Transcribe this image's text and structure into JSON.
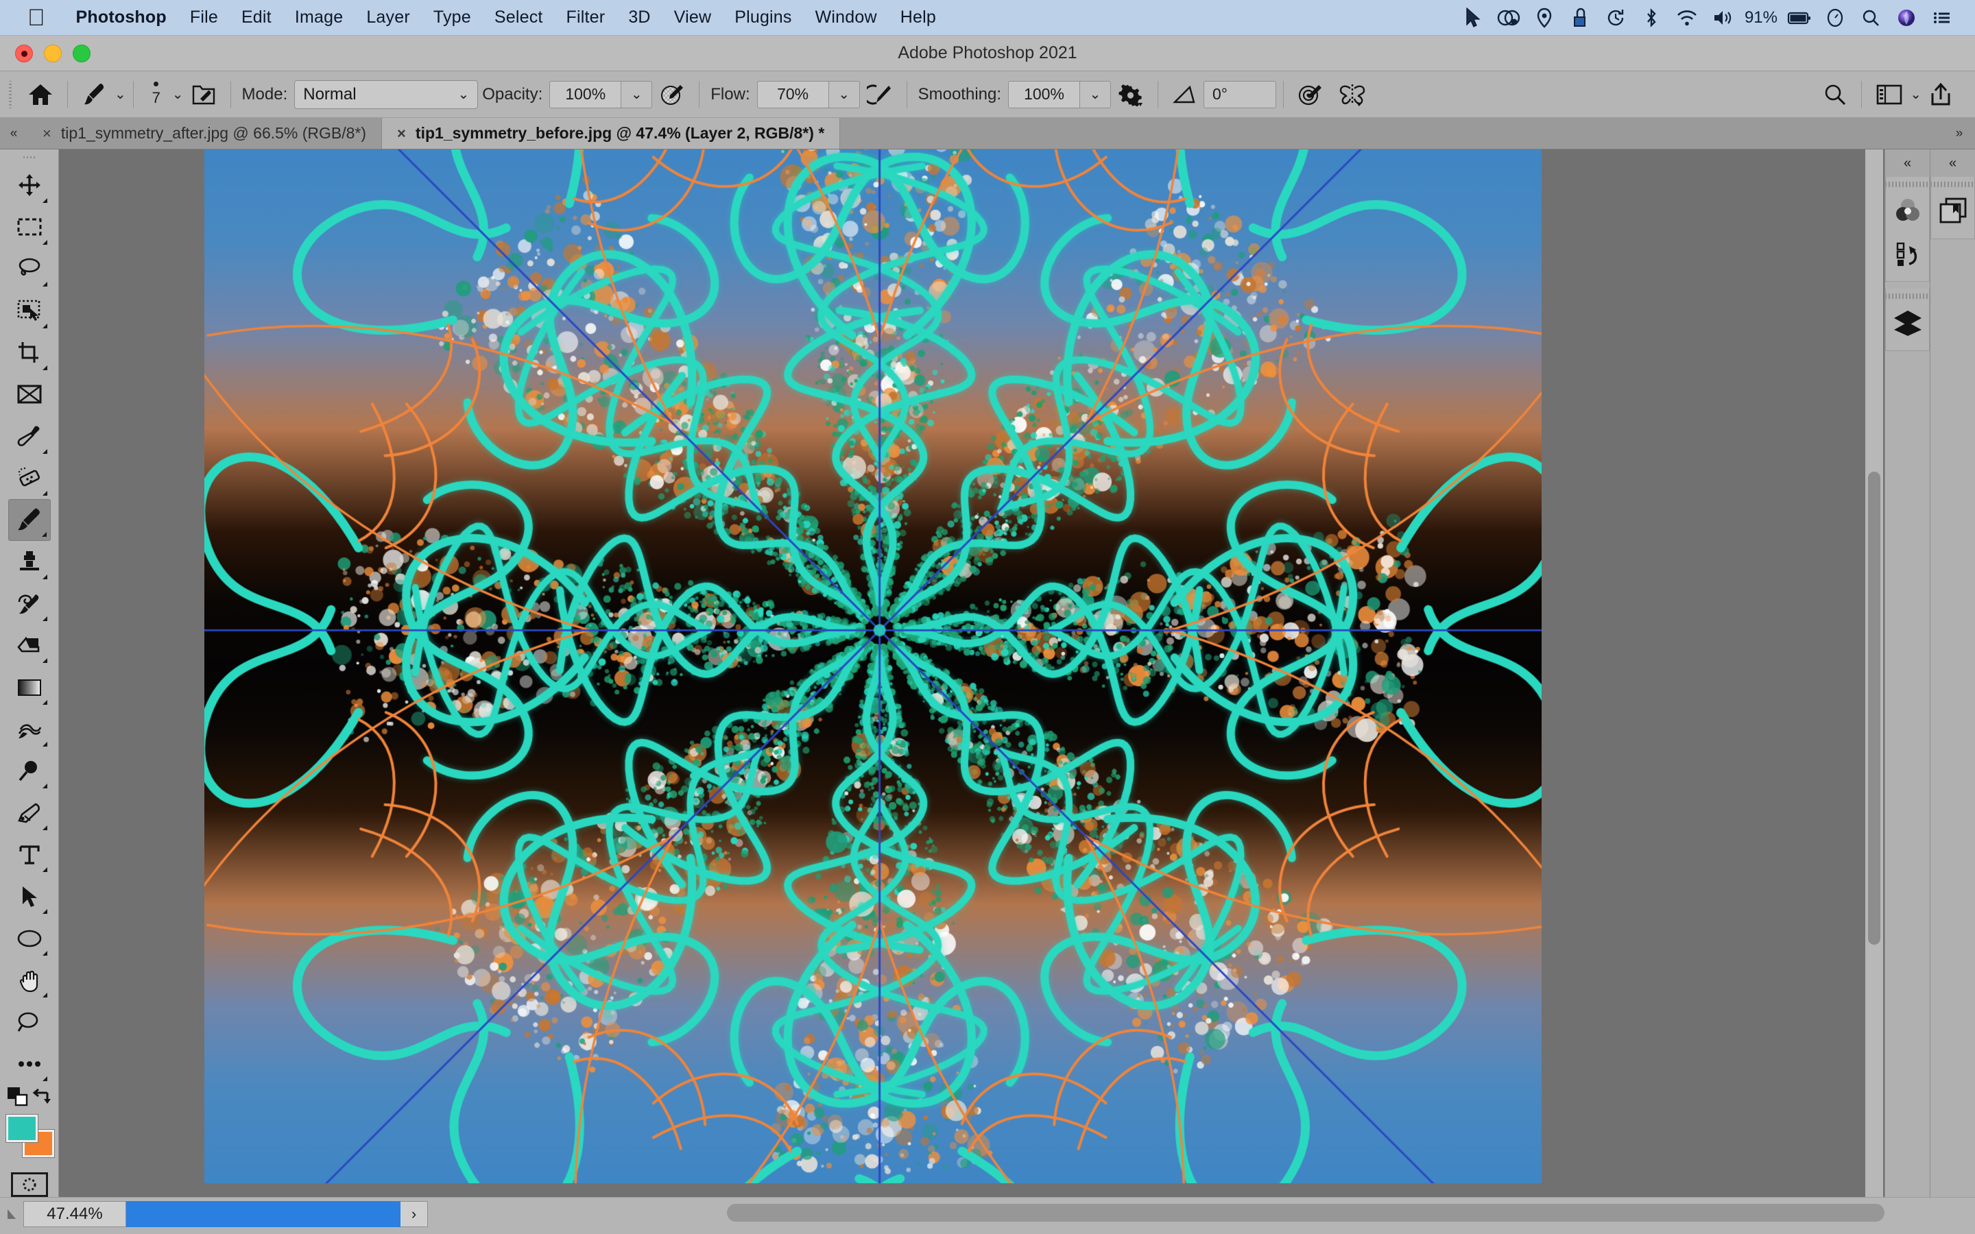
{
  "macos_menu": {
    "apple_icon": "apple-icon",
    "items": [
      {
        "label": "Photoshop",
        "bold": true
      },
      {
        "label": "File",
        "bold": false
      },
      {
        "label": "Edit",
        "bold": false
      },
      {
        "label": "Image",
        "bold": false
      },
      {
        "label": "Layer",
        "bold": false
      },
      {
        "label": "Type",
        "bold": false
      },
      {
        "label": "Select",
        "bold": false
      },
      {
        "label": "Filter",
        "bold": false
      },
      {
        "label": "3D",
        "bold": false
      },
      {
        "label": "View",
        "bold": false
      },
      {
        "label": "Plugins",
        "bold": false
      },
      {
        "label": "Window",
        "bold": false
      },
      {
        "label": "Help",
        "bold": false
      }
    ],
    "status_icons": [
      "cursor-icon",
      "screen-sharing-icon",
      "location-icon",
      "camera-icon",
      "time-machine-icon",
      "bluetooth-icon",
      "wifi-icon",
      "volume-icon"
    ],
    "battery_percent": "91%",
    "trailing_icons": [
      "battery-icon",
      "control-center-icon",
      "spotlight-search-icon",
      "siri-icon",
      "notification-center-icon"
    ],
    "menubar_bg": "#bcd0e8"
  },
  "window": {
    "title": "Adobe Photoshop 2021",
    "traffic_lights": [
      "close-button",
      "minimize-button",
      "zoom-button"
    ]
  },
  "options_bar": {
    "home_icon": "home-icon",
    "brush_preset_icon": "brush-preset-icon",
    "brush_size_value": "7",
    "brush_panel_icon": "brush-settings-panel-icon",
    "mode_label": "Mode:",
    "mode_value": "Normal",
    "opacity_label": "Opacity:",
    "opacity_value": "100%",
    "pressure_opacity_icon": "pressure-controls-opacity-icon",
    "flow_label": "Flow:",
    "flow_value": "70%",
    "airbrush_icon": "airbrush-icon",
    "smoothing_label": "Smoothing:",
    "smoothing_value": "100%",
    "smoothing_options_icon": "smoothing-options-gear-icon",
    "angle_icon": "brush-angle-icon",
    "angle_value": "0°",
    "pressure_size_icon": "pressure-controls-size-icon",
    "symmetry_icon": "symmetry-butterfly-icon",
    "search_icon": "search-icon",
    "workspace_icon": "workspace-switcher-icon",
    "workspace_chevron": "chevron-down-icon",
    "share_icon": "share-icon"
  },
  "tabs": {
    "left_scroll": "«",
    "right_scroll": "»",
    "items": [
      {
        "close": "×",
        "label": "tip1_symmetry_after.jpg @ 66.5% (RGB/8*)",
        "active": false
      },
      {
        "close": "×",
        "label": "tip1_symmetry_before.jpg @ 47.4% (Layer 2, RGB/8*) *",
        "active": true
      }
    ]
  },
  "toolbox": {
    "tools": [
      {
        "name": "move-tool",
        "active": false,
        "corner": true
      },
      {
        "name": "rectangular-marquee-tool",
        "active": false,
        "corner": true
      },
      {
        "name": "lasso-tool",
        "active": false,
        "corner": true
      },
      {
        "name": "object-selection-tool",
        "active": false,
        "corner": true
      },
      {
        "name": "crop-tool",
        "active": false,
        "corner": true
      },
      {
        "name": "frame-tool",
        "active": false,
        "corner": false
      },
      {
        "name": "eyedropper-tool",
        "active": false,
        "corner": true
      },
      {
        "name": "spot-healing-brush-tool",
        "active": false,
        "corner": true
      },
      {
        "name": "brush-tool",
        "active": true,
        "corner": true
      },
      {
        "name": "clone-stamp-tool",
        "active": false,
        "corner": true
      },
      {
        "name": "history-brush-tool",
        "active": false,
        "corner": true
      },
      {
        "name": "eraser-tool",
        "active": false,
        "corner": true
      },
      {
        "name": "gradient-tool",
        "active": false,
        "corner": true
      },
      {
        "name": "blur-tool",
        "active": false,
        "corner": true
      },
      {
        "name": "dodge-tool",
        "active": false,
        "corner": true
      },
      {
        "name": "pen-tool",
        "active": false,
        "corner": true
      },
      {
        "name": "horizontal-type-tool",
        "active": false,
        "corner": true
      },
      {
        "name": "path-selection-tool",
        "active": false,
        "corner": true
      },
      {
        "name": "ellipse-shape-tool",
        "active": false,
        "corner": true
      },
      {
        "name": "hand-tool",
        "active": false,
        "corner": true
      },
      {
        "name": "zoom-tool",
        "active": false,
        "corner": false
      },
      {
        "name": "edit-toolbar-more-tool",
        "active": false,
        "corner": true
      }
    ],
    "default_colors_icon": "default-foreground-background-colors-icon",
    "swap_colors_icon": "swap-foreground-background-colors-icon",
    "foreground_color": "#2bc7b4",
    "background_color": "#f5822f",
    "quick_mask_icon": "quick-mask-mode-icon"
  },
  "right_panels": {
    "collapse_icon": "collapse-panels-icon",
    "column_a": [
      "color-panel-icon",
      "history-panel-icon",
      "layers-panel-icon"
    ],
    "column_b": [
      "libraries-panel-icon"
    ]
  },
  "status_bar": {
    "resize_grip_icon": "resize-grip-icon",
    "zoom_value": "47.44%",
    "info_bar_color": "#2a7fe0",
    "info_arrow": "›",
    "hscroll_icon": "horizontal-scrollbar"
  },
  "canvas": {
    "document": "tip1_symmetry_before.jpg",
    "zoom_level": "47.4%",
    "layer": "Layer 2",
    "color_mode": "RGB/8*",
    "artwork": {
      "description": "Radial mandala symmetry painting over a sunset-gradient photo",
      "symmetry_type": "radial",
      "symmetry_segments": 8,
      "guide_color": "#2b47c4",
      "stroke_color_primary": "#2ad8c0",
      "stroke_color_secondary": "#f0843a",
      "particle_colors": [
        "#f0903c",
        "#e8e2d8",
        "#c8762e",
        "#ffffff",
        "#1f9e7a"
      ],
      "background_gradient": [
        "#3f86c4",
        "#b3764f",
        "#050404",
        "#b2764e",
        "#3f86c4"
      ]
    }
  }
}
